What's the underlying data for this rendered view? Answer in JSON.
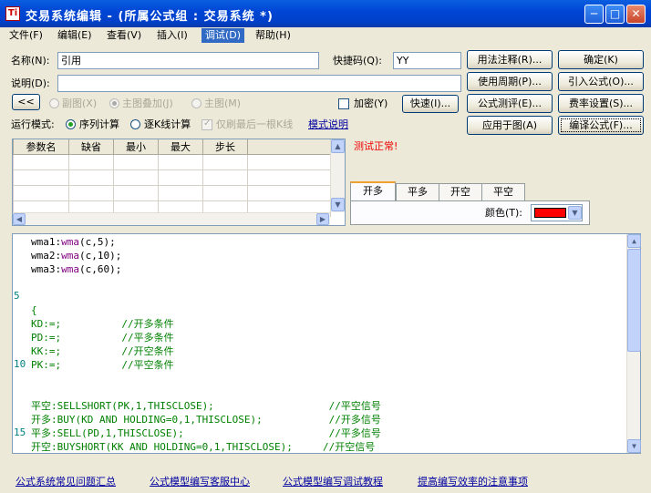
{
  "window": {
    "title": "交易系统编辑 - (所属公式组 : 交易系统 *)",
    "app_icon": "Ti",
    "minimize": "─",
    "maximize": "□",
    "close": "✕"
  },
  "menu": [
    "文件(F)",
    "编辑(E)",
    "查看(V)",
    "插入(I)",
    "调试(D)",
    "帮助(H)"
  ],
  "form": {
    "name_label": "名称(N):",
    "name_value": "引用",
    "shortcut_label": "快捷码(Q):",
    "shortcut_value": "YY",
    "desc_label": "说明(D):",
    "desc_value": "",
    "collapse": "<<",
    "sub_chart": "副图(X)",
    "main_overlay": "主图叠加(J)",
    "main_chart": "主图(M)",
    "encrypt": "加密(Y)",
    "quick": "快速(I)...",
    "run_mode_label": "运行模式:",
    "seq_calc": "序列计算",
    "kline_calc": "逐K线计算",
    "last_only": "仅刷最后一根K线",
    "mode_help": "模式说明"
  },
  "buttons": {
    "usage_notes": "用法注释(R)...",
    "confirm": "确定(K)",
    "usage_period": "使用周期(P)...",
    "import_formula": "引入公式(O)...",
    "formula_test": "公式测评(E)...",
    "fee_settings": "费率设置(S)...",
    "apply_chart": "应用于图(A)",
    "compile": "编译公式(F)..."
  },
  "param_table": {
    "headers": [
      "参数名",
      "缺省",
      "最小",
      "最大",
      "步长"
    ],
    "rows": [
      [
        "",
        "",
        "",
        "",
        ""
      ],
      [
        "",
        "",
        "",
        "",
        ""
      ],
      [
        "",
        "",
        "",
        "",
        ""
      ],
      [
        "",
        "",
        "",
        "",
        ""
      ]
    ]
  },
  "status": "测试正常!",
  "signal_tabs": [
    "开多",
    "平多",
    "开空",
    "平空"
  ],
  "color_label": "颜色(T):",
  "color_value": "#ff0000",
  "editor": {
    "line_numbers": [
      "5",
      "10",
      "15"
    ],
    "lines": [
      [
        {
          "t": "wma1:",
          "c": ""
        },
        {
          "t": "wma",
          "c": "fn"
        },
        {
          "t": "(c,5);",
          "c": ""
        }
      ],
      [
        {
          "t": "wma2:",
          "c": ""
        },
        {
          "t": "wma",
          "c": "fn"
        },
        {
          "t": "(c,10);",
          "c": ""
        }
      ],
      [
        {
          "t": "wma3:",
          "c": ""
        },
        {
          "t": "wma",
          "c": "fn"
        },
        {
          "t": "(c,60);",
          "c": ""
        }
      ],
      [],
      [],
      [
        {
          "t": "{",
          "c": "cm"
        }
      ],
      [
        {
          "t": "KD:=;          //开多条件",
          "c": "cm"
        }
      ],
      [
        {
          "t": "PD:=;          //平多条件",
          "c": "cm"
        }
      ],
      [
        {
          "t": "KK:=;          //开空条件",
          "c": "cm"
        }
      ],
      [
        {
          "t": "PK:=;          //平空条件",
          "c": "cm"
        }
      ],
      [],
      [],
      [
        {
          "t": "平空:SELLSHORT(PK,1,THISCLOSE);",
          "c": "hz"
        },
        {
          "t": "                   //平空信号",
          "c": "cm"
        }
      ],
      [
        {
          "t": "开多:BUY(KD AND HOLDING=0,1,THISCLOSE);",
          "c": "hz"
        },
        {
          "t": "           //开多信号",
          "c": "cm"
        }
      ],
      [
        {
          "t": "平多:SELL(PD,1,THISCLOSE);",
          "c": "hz"
        },
        {
          "t": "                        //平多信号",
          "c": "cm"
        }
      ],
      [
        {
          "t": "开空:BUYSHORT(KK AND HOLDING=0,1,THISCLOSE);",
          "c": "hz"
        },
        {
          "t": "     //开空信号",
          "c": "cm"
        }
      ]
    ]
  },
  "footer_links": [
    "公式系统常见问题汇总",
    "公式模型编写客服中心",
    "公式模型编写调试教程",
    "提高编写效率的注意事项"
  ]
}
